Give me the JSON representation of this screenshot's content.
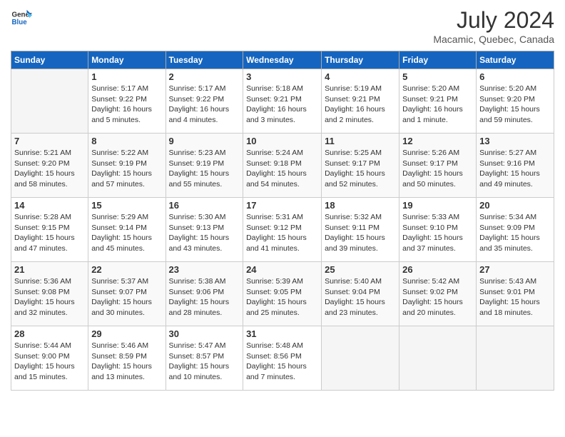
{
  "header": {
    "logo": "GeneralBlue",
    "month_year": "July 2024",
    "location": "Macamic, Quebec, Canada"
  },
  "weekdays": [
    "Sunday",
    "Monday",
    "Tuesday",
    "Wednesday",
    "Thursday",
    "Friday",
    "Saturday"
  ],
  "weeks": [
    [
      {
        "day": "",
        "info": ""
      },
      {
        "day": "1",
        "info": "Sunrise: 5:17 AM\nSunset: 9:22 PM\nDaylight: 16 hours\nand 5 minutes."
      },
      {
        "day": "2",
        "info": "Sunrise: 5:17 AM\nSunset: 9:22 PM\nDaylight: 16 hours\nand 4 minutes."
      },
      {
        "day": "3",
        "info": "Sunrise: 5:18 AM\nSunset: 9:21 PM\nDaylight: 16 hours\nand 3 minutes."
      },
      {
        "day": "4",
        "info": "Sunrise: 5:19 AM\nSunset: 9:21 PM\nDaylight: 16 hours\nand 2 minutes."
      },
      {
        "day": "5",
        "info": "Sunrise: 5:20 AM\nSunset: 9:21 PM\nDaylight: 16 hours\nand 1 minute."
      },
      {
        "day": "6",
        "info": "Sunrise: 5:20 AM\nSunset: 9:20 PM\nDaylight: 15 hours\nand 59 minutes."
      }
    ],
    [
      {
        "day": "7",
        "info": "Sunrise: 5:21 AM\nSunset: 9:20 PM\nDaylight: 15 hours\nand 58 minutes."
      },
      {
        "day": "8",
        "info": "Sunrise: 5:22 AM\nSunset: 9:19 PM\nDaylight: 15 hours\nand 57 minutes."
      },
      {
        "day": "9",
        "info": "Sunrise: 5:23 AM\nSunset: 9:19 PM\nDaylight: 15 hours\nand 55 minutes."
      },
      {
        "day": "10",
        "info": "Sunrise: 5:24 AM\nSunset: 9:18 PM\nDaylight: 15 hours\nand 54 minutes."
      },
      {
        "day": "11",
        "info": "Sunrise: 5:25 AM\nSunset: 9:17 PM\nDaylight: 15 hours\nand 52 minutes."
      },
      {
        "day": "12",
        "info": "Sunrise: 5:26 AM\nSunset: 9:17 PM\nDaylight: 15 hours\nand 50 minutes."
      },
      {
        "day": "13",
        "info": "Sunrise: 5:27 AM\nSunset: 9:16 PM\nDaylight: 15 hours\nand 49 minutes."
      }
    ],
    [
      {
        "day": "14",
        "info": "Sunrise: 5:28 AM\nSunset: 9:15 PM\nDaylight: 15 hours\nand 47 minutes."
      },
      {
        "day": "15",
        "info": "Sunrise: 5:29 AM\nSunset: 9:14 PM\nDaylight: 15 hours\nand 45 minutes."
      },
      {
        "day": "16",
        "info": "Sunrise: 5:30 AM\nSunset: 9:13 PM\nDaylight: 15 hours\nand 43 minutes."
      },
      {
        "day": "17",
        "info": "Sunrise: 5:31 AM\nSunset: 9:12 PM\nDaylight: 15 hours\nand 41 minutes."
      },
      {
        "day": "18",
        "info": "Sunrise: 5:32 AM\nSunset: 9:11 PM\nDaylight: 15 hours\nand 39 minutes."
      },
      {
        "day": "19",
        "info": "Sunrise: 5:33 AM\nSunset: 9:10 PM\nDaylight: 15 hours\nand 37 minutes."
      },
      {
        "day": "20",
        "info": "Sunrise: 5:34 AM\nSunset: 9:09 PM\nDaylight: 15 hours\nand 35 minutes."
      }
    ],
    [
      {
        "day": "21",
        "info": "Sunrise: 5:36 AM\nSunset: 9:08 PM\nDaylight: 15 hours\nand 32 minutes."
      },
      {
        "day": "22",
        "info": "Sunrise: 5:37 AM\nSunset: 9:07 PM\nDaylight: 15 hours\nand 30 minutes."
      },
      {
        "day": "23",
        "info": "Sunrise: 5:38 AM\nSunset: 9:06 PM\nDaylight: 15 hours\nand 28 minutes."
      },
      {
        "day": "24",
        "info": "Sunrise: 5:39 AM\nSunset: 9:05 PM\nDaylight: 15 hours\nand 25 minutes."
      },
      {
        "day": "25",
        "info": "Sunrise: 5:40 AM\nSunset: 9:04 PM\nDaylight: 15 hours\nand 23 minutes."
      },
      {
        "day": "26",
        "info": "Sunrise: 5:42 AM\nSunset: 9:02 PM\nDaylight: 15 hours\nand 20 minutes."
      },
      {
        "day": "27",
        "info": "Sunrise: 5:43 AM\nSunset: 9:01 PM\nDaylight: 15 hours\nand 18 minutes."
      }
    ],
    [
      {
        "day": "28",
        "info": "Sunrise: 5:44 AM\nSunset: 9:00 PM\nDaylight: 15 hours\nand 15 minutes."
      },
      {
        "day": "29",
        "info": "Sunrise: 5:46 AM\nSunset: 8:59 PM\nDaylight: 15 hours\nand 13 minutes."
      },
      {
        "day": "30",
        "info": "Sunrise: 5:47 AM\nSunset: 8:57 PM\nDaylight: 15 hours\nand 10 minutes."
      },
      {
        "day": "31",
        "info": "Sunrise: 5:48 AM\nSunset: 8:56 PM\nDaylight: 15 hours\nand 7 minutes."
      },
      {
        "day": "",
        "info": ""
      },
      {
        "day": "",
        "info": ""
      },
      {
        "day": "",
        "info": ""
      }
    ]
  ]
}
